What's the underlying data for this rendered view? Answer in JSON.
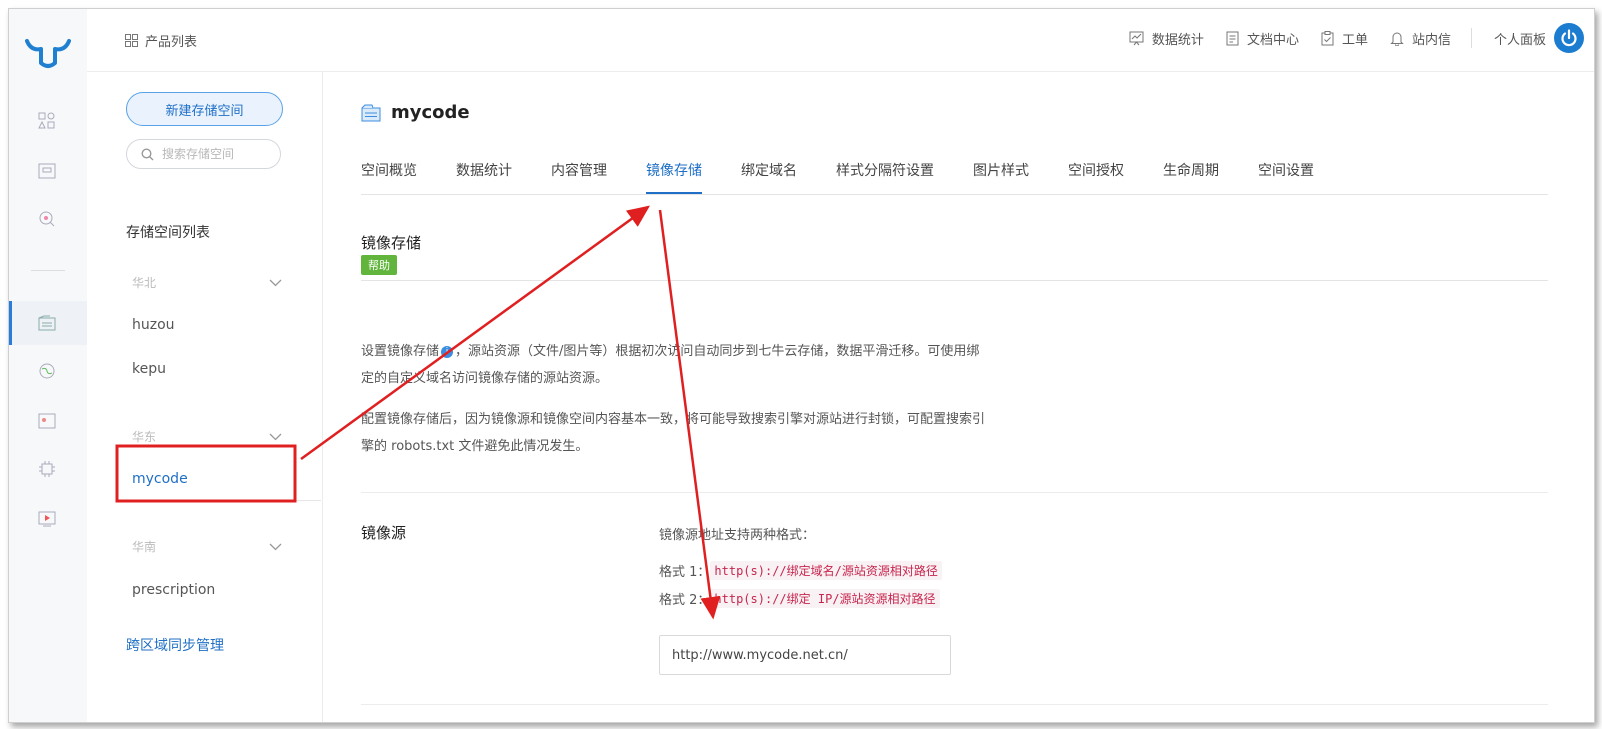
{
  "header": {
    "product_list": "产品列表",
    "nav": [
      {
        "icon": "chart-icon",
        "label": "数据统计"
      },
      {
        "icon": "document-icon",
        "label": "文档中心"
      },
      {
        "icon": "clipboard-icon",
        "label": "工单"
      },
      {
        "icon": "bell-icon",
        "label": "站内信"
      }
    ],
    "personal_panel": "个人面板"
  },
  "sidebar": {
    "new_bucket": "新建存储空间",
    "search_placeholder": "搜索存储空间",
    "list_title": "存储空间列表",
    "regions": [
      {
        "name": "华北",
        "buckets": [
          "huzou",
          "kepu"
        ]
      },
      {
        "name": "华东",
        "buckets": [
          "mycode"
        ]
      },
      {
        "name": "华南",
        "buckets": [
          "prescription"
        ]
      }
    ],
    "active_bucket": "mycode",
    "cross_region": "跨区域同步管理"
  },
  "main": {
    "bucket_name": "mycode",
    "tabs": [
      "空间概览",
      "数据统计",
      "内容管理",
      "镜像存储",
      "绑定域名",
      "样式分隔符设置",
      "图片样式",
      "空间授权",
      "生命周期",
      "空间设置"
    ],
    "active_tab": "镜像存储",
    "section_title": "镜像存储",
    "help": "帮助",
    "para1_a": "设置镜像存储",
    "para1_b": "，源站资源（文件/图片等）根据初次访问自动同步到七牛云存储，数据平滑迁移。可使用绑定的自定义域名访问镜像存储的源站资源。",
    "para2": "配置镜像存储后，因为镜像源和镜像空间内容基本一致，将可能导致搜索引擎对源站进行封锁，可配置搜索引擎的 robots.txt 文件避免此情况发生。",
    "source_label": "镜像源",
    "format_intro": "镜像源地址支持两种格式：",
    "format1_label": "格式 1：",
    "format1_code": "http(s)://绑定域名/源站资源相对路径",
    "format2_label": "格式 2：",
    "format2_code": "http(s)://绑定 IP/源站资源相对路径",
    "source_value": "http://www.mycode.net.cn/"
  },
  "colors": {
    "accent": "#1f6fc6",
    "help_badge": "#61b53c",
    "annotation": "#e02020"
  }
}
